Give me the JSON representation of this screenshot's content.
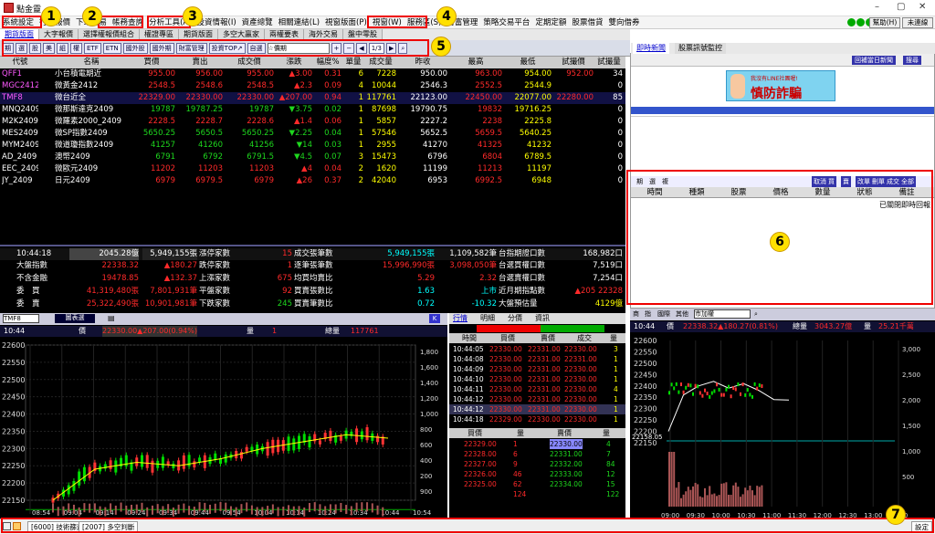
{
  "app": {
    "title": "點金靈"
  },
  "menu": [
    "系統設定",
    "行情報價",
    "下單交易",
    "帳務查詢",
    "分析工具(A)",
    "投資情報(I)",
    "資產總覽",
    "相關連結(L)",
    "視窗版面(P)",
    "視窗(W)",
    "服務區(S)",
    "財富管理",
    "策略交易平台",
    "定期定額",
    "股票借貸",
    "雙向借券"
  ],
  "menu_buttons": {
    "help": "幫助(H)",
    "login": "未連線"
  },
  "tabs": [
    "期貨版面",
    "大字報價",
    "選擇權報價組合",
    "權證專區",
    "期貨版面",
    "多空大贏家",
    "兩權要表",
    "海外交易",
    "盤中零股"
  ],
  "toolbar": {
    "buttons": [
      "期",
      "選",
      "股",
      "美",
      "組",
      "權",
      "ETF",
      "ETN",
      "國外股",
      "國外期",
      "財富管理",
      "投資TOP↗",
      "自選"
    ],
    "select": "☆價期",
    "page": "1/3"
  },
  "quote": {
    "headers": [
      "代號",
      "名稱",
      "買價",
      "賣出",
      "成交價",
      "漲跌",
      "幅度%",
      "單量",
      "成交量",
      "昨收",
      "最高",
      "最低",
      "試撮價",
      "試撮量"
    ],
    "rows": [
      {
        "code": "QFF1",
        "name": "小台積電期近",
        "bid": "955.00",
        "ask": "956.00",
        "last": "955.00",
        "chg": "▲3.00",
        "pct": "0.31",
        "vol": "6",
        "total": "7228",
        "prev": "950.00",
        "high": "963.00",
        "low": "954.00",
        "tprice": "952.00",
        "tvol": "34",
        "dir": "up"
      },
      {
        "code": "MGC2412",
        "name": "微黃金2412",
        "bid": "2548.5",
        "ask": "2548.6",
        "last": "2548.5",
        "chg": "▲2.3",
        "pct": "0.09",
        "vol": "4",
        "total": "10044",
        "prev": "2546.3",
        "high": "2552.5",
        "low": "2544.9",
        "tprice": "",
        "tvol": "0",
        "dir": "up"
      },
      {
        "code": "TMF8",
        "name": "微台近全",
        "bid": "22329.00",
        "ask": "22330.00",
        "last": "22330.00",
        "chg": "▲207.00",
        "pct": "0.94",
        "vol": "1",
        "total": "117761",
        "prev": "22123.00",
        "high": "22450.00",
        "low": "22077.00",
        "tprice": "22280.00",
        "tvol": "85",
        "dir": "up"
      },
      {
        "code": "MNQ2409",
        "name": "微那斯達克2409",
        "bid": "19787",
        "ask": "19787.25",
        "last": "19787",
        "chg": "▼3.75",
        "pct": "0.02",
        "vol": "1",
        "total": "87698",
        "prev": "19790.75",
        "high": "19832",
        "low": "19716.25",
        "tprice": "",
        "tvol": "0",
        "dir": "dn"
      },
      {
        "code": "M2K2409",
        "name": "微羅素2000_2409",
        "bid": "2228.5",
        "ask": "2228.7",
        "last": "2228.6",
        "chg": "▲1.4",
        "pct": "0.06",
        "vol": "1",
        "total": "5857",
        "prev": "2227.2",
        "high": "2238",
        "low": "2225.8",
        "tprice": "",
        "tvol": "0",
        "dir": "up"
      },
      {
        "code": "MES2409",
        "name": "微SP指數2409",
        "bid": "5650.25",
        "ask": "5650.5",
        "last": "5650.25",
        "chg": "▼2.25",
        "pct": "0.04",
        "vol": "1",
        "total": "57546",
        "prev": "5652.5",
        "high": "5659.5",
        "low": "5640.25",
        "tprice": "",
        "tvol": "0",
        "dir": "dn"
      },
      {
        "code": "MYM2409",
        "name": "微道瓊指數2409",
        "bid": "41257",
        "ask": "41260",
        "last": "41256",
        "chg": "▼14",
        "pct": "0.03",
        "vol": "1",
        "total": "2955",
        "prev": "41270",
        "high": "41325",
        "low": "41232",
        "tprice": "",
        "tvol": "0",
        "dir": "dn"
      },
      {
        "code": "AD_2409",
        "name": "澳幣2409",
        "bid": "6791",
        "ask": "6792",
        "last": "6791.5",
        "chg": "▼4.5",
        "pct": "0.07",
        "vol": "3",
        "total": "15473",
        "prev": "6796",
        "high": "6804",
        "low": "6789.5",
        "tprice": "",
        "tvol": "0",
        "dir": "dn"
      },
      {
        "code": "EEC_2409",
        "name": "微歐元2409",
        "bid": "11202",
        "ask": "11203",
        "last": "11203",
        "chg": "▲4",
        "pct": "0.04",
        "vol": "2",
        "total": "1620",
        "prev": "11199",
        "high": "11213",
        "low": "11197",
        "tprice": "",
        "tvol": "0",
        "dir": "up"
      },
      {
        "code": "JY_2409",
        "name": "日元2409",
        "bid": "6979",
        "ask": "6979.5",
        "last": "6979",
        "chg": "▲26",
        "pct": "0.37",
        "vol": "2",
        "total": "42040",
        "prev": "6953",
        "high": "6992.5",
        "low": "6948",
        "tprice": "",
        "tvol": "0",
        "dir": "up"
      }
    ]
  },
  "summary": {
    "time": "10:44:18",
    "amt": "2045.28億",
    "s1": "5,949,155張",
    "l1": "漲停家數",
    "n1": "15",
    "l1b": "成交張筆數",
    "v1": "5,949,155張",
    "v1b": "1,109,582筆",
    "l1c": "台指期證口數",
    "v1c": "168,982口",
    "r2": [
      "大盤指數",
      "22338.32",
      "▲180.27",
      "跌停家數",
      "1",
      "逐筆張筆數",
      "15,996,990張",
      "3,098,050筆",
      "台選買權口數",
      "7,519口"
    ],
    "r3": [
      "不含金融",
      "19478.85",
      "▲132.37",
      "上漲家數",
      "675",
      "均買均賣比",
      "5.29",
      "2.32",
      "台選賣權口數",
      "7,254口"
    ],
    "r4": [
      "委　買",
      "41,319,480張",
      "7,801,931筆",
      "平盤家數",
      "92",
      "買賣張數比",
      "1.63",
      "上市",
      "近月期指點數",
      "▲205 22328"
    ],
    "r5": [
      "委　賣",
      "25,322,490張",
      "10,901,981筆",
      "下跌家數",
      "245",
      "買賣筆數比",
      "0.72",
      "-10.32",
      "大盤預估量",
      "4129億"
    ]
  },
  "chartL": {
    "select": "TMF8",
    "btn": "圖表選",
    "time": "10:44",
    "price_lbl": "價",
    "price": "22330.00▲207.00(0.94%)",
    "vol_lbl": "量",
    "vol": "1",
    "total_lbl": "總量",
    "total": "117761",
    "yticks": [
      "22600",
      "22550",
      "22500",
      "22450",
      "22400",
      "22350",
      "22300",
      "22250",
      "22200",
      "22150"
    ],
    "y2ticks": [
      "1,800",
      "1,600",
      "1,400",
      "1,200",
      "1,000",
      "800",
      "600",
      "400",
      "200",
      "900"
    ],
    "xticks": [
      "08:54",
      "09:04",
      "09:14",
      "09:24",
      "09:34",
      "09:44",
      "09:54",
      "10:04",
      "10:14",
      "10:24",
      "10:34",
      "10:44",
      "10:54"
    ],
    "ref": "22123.00"
  },
  "chart_data": {
    "type": "line",
    "title": "",
    "x": [
      "08:45",
      "09:00",
      "09:15",
      "09:30",
      "09:45",
      "10:00",
      "10:15",
      "10:30",
      "10:44"
    ],
    "series": [
      {
        "name": "",
        "values": [
          22150,
          22240,
          22260,
          22250,
          22270,
          22300,
          22320,
          22340,
          22330
        ]
      }
    ],
    "ylim": [
      22150,
      22600
    ]
  },
  "ticks": {
    "tabs": [
      "行情",
      "明細",
      "分價",
      "資訊"
    ],
    "headers": [
      "時間",
      "買價",
      "賣價",
      "成交",
      "量"
    ],
    "rows": [
      [
        "10:44:05",
        "22330.00",
        "22331.00",
        "22330.00",
        "3"
      ],
      [
        "10:44:08",
        "22330.00",
        "22331.00",
        "22331.00",
        "1"
      ],
      [
        "10:44:09",
        "22330.00",
        "22331.00",
        "22330.00",
        "1"
      ],
      [
        "10:44:10",
        "22330.00",
        "22331.00",
        "22330.00",
        "1"
      ],
      [
        "10:44:11",
        "22330.00",
        "22331.00",
        "22330.00",
        "4"
      ],
      [
        "10:44:12",
        "22330.00",
        "22331.00",
        "22330.00",
        "1"
      ],
      [
        "10:44:12",
        "22330.00",
        "22331.00",
        "22330.00",
        "1"
      ],
      [
        "10:44:18",
        "22329.00",
        "22330.00",
        "22330.00",
        "1"
      ]
    ],
    "book_headers": [
      "買價",
      "量",
      "賣價",
      "量"
    ],
    "book": [
      [
        "22329.00",
        "1",
        "22330.00",
        "4"
      ],
      [
        "22328.00",
        "6",
        "22331.00",
        "7"
      ],
      [
        "22327.00",
        "9",
        "22332.00",
        "84"
      ],
      [
        "22326.00",
        "46",
        "22333.00",
        "12"
      ],
      [
        "22325.00",
        "62",
        "22334.00",
        "15"
      ],
      [
        "",
        "124",
        "",
        "122"
      ]
    ]
  },
  "rightpanel": {
    "tabs": [
      "即時新聞",
      "股票訊號監控"
    ],
    "buttons": [
      "回補當日新聞",
      "搜尋"
    ],
    "ad": "慎防詐騙",
    "ad_sub": "我沒有LINE社團喔!",
    "order_toolbar": [
      "期",
      "選",
      "複",
      "取消",
      "買",
      "賣",
      "改單",
      "刪單",
      "成交",
      "全部"
    ],
    "order_headers": [
      "時間",
      "種類",
      "股票",
      "價格",
      "數量",
      "狀態",
      "備註"
    ],
    "status_note": "已關閉即時回報"
  },
  "chartR": {
    "btns": [
      "商",
      "指",
      "國際",
      "其他"
    ],
    "select": "市加權",
    "time": "10:44",
    "price_lbl": "價",
    "price": "22338.32▲180.27(0.81%)",
    "total_lbl": "總量",
    "total": "3043.27億",
    "vol_lbl": "量",
    "vol": "25.21千萬",
    "yticks": [
      "22600",
      "22550",
      "22500",
      "22450",
      "22400",
      "22350",
      "22300",
      "22250",
      "22200",
      "22150"
    ],
    "y2ticks": [
      "3,000",
      "2,500",
      "2,000",
      "1,500",
      "1,000",
      "500"
    ],
    "xticks": [
      "09:00",
      "09:30",
      "10:00",
      "10:30",
      "11:00",
      "11:30",
      "12:00",
      "12:30",
      "13:00",
      "13:30"
    ],
    "ref": "22158.05"
  },
  "status": {
    "items": [
      "[6000] 技術篩選",
      "[2007] 多空判斷"
    ],
    "right": "設定"
  },
  "badges": [
    "1",
    "2",
    "3",
    "4",
    "5",
    "6",
    "7"
  ]
}
